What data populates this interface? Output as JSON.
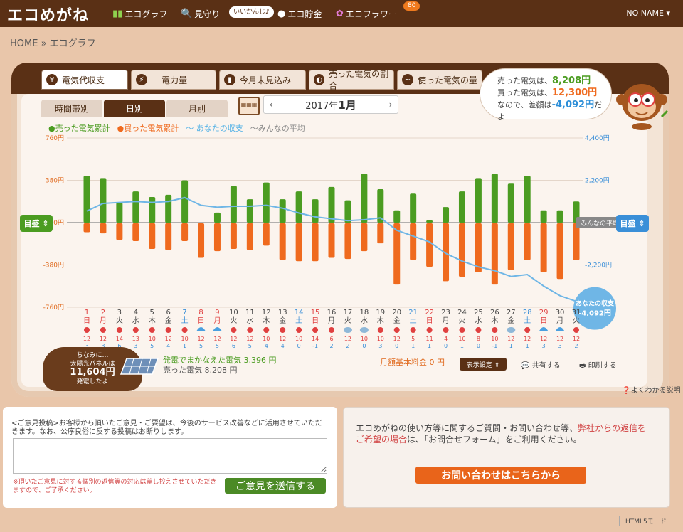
{
  "header": {
    "logo": "エコめがね",
    "nav": [
      {
        "label": "エコグラフ",
        "icon": "bar-chart-icon"
      },
      {
        "label": "見守り",
        "icon": "magnifier-icon"
      },
      {
        "label": "エコ貯金",
        "icon": "coin-icon"
      },
      {
        "label": "エコフラワー",
        "icon": "flower-icon"
      }
    ],
    "tag": "いいかんじ♪",
    "badge": "80",
    "user": "NO NAME ▾"
  },
  "breadcrumb": "HOME » エコグラフ",
  "tabs": [
    {
      "label": "電気代収支",
      "icon": "¥"
    },
    {
      "label": "電力量",
      "icon": "⚡"
    },
    {
      "label": "今月末見込み",
      "icon": "▮"
    },
    {
      "label": "売った電気の割合",
      "icon": "◐"
    },
    {
      "label": "使った電気の量",
      "icon": "~"
    }
  ],
  "subtabs": [
    "時間帯別",
    "日別",
    "月別"
  ],
  "month": {
    "prev": "‹",
    "year": "2017年",
    "mon": "1月",
    "next": "›"
  },
  "summary": {
    "sold_label": "売った電気は、",
    "sold_value": "8,208円",
    "bought_label": "買った電気は、",
    "bought_value": "12,300円",
    "diff_label": "なので、差額は",
    "diff_value": "-4,092円",
    "diff_suffix": "だよ"
  },
  "legend": {
    "sold": "●売った電気累計",
    "bought": "●買った電気累計",
    "balance": "〜 あなたの収支",
    "avg": "〜みんなの平均"
  },
  "meyasu": "目盛",
  "chart_data": {
    "type": "bar",
    "left_axis": {
      "ticks": [
        "760円",
        "380円",
        "0円",
        "-380円",
        "-760円"
      ],
      "range": [
        -760,
        760
      ]
    },
    "right_axis": {
      "ticks": [
        "4,400円",
        "2,200円",
        "",
        "-2,200円"
      ],
      "range": [
        -4400,
        4400
      ]
    },
    "avg_label": "みんなの平均",
    "balance_callout": {
      "title": "あなたの収支",
      "value": "-4,092円"
    },
    "days": [
      "1",
      "2",
      "3",
      "4",
      "5",
      "6",
      "7",
      "8",
      "9",
      "10",
      "11",
      "12",
      "13",
      "14",
      "15",
      "16",
      "17",
      "18",
      "19",
      "20",
      "21",
      "22",
      "23",
      "24",
      "25",
      "26",
      "27",
      "28",
      "29",
      "30",
      "31"
    ],
    "weekdays": [
      "日",
      "月",
      "火",
      "水",
      "木",
      "金",
      "土",
      "日",
      "月",
      "火",
      "水",
      "木",
      "金",
      "土",
      "日",
      "月",
      "火",
      "水",
      "木",
      "金",
      "土",
      "日",
      "月",
      "火",
      "水",
      "木",
      "金",
      "土",
      "日",
      "月",
      "火"
    ],
    "weekday_colors": [
      "#e04040",
      "#e04040",
      "#444",
      "#444",
      "#444",
      "#444",
      "#3a8fd8",
      "#e04040",
      "#e04040",
      "#444",
      "#444",
      "#444",
      "#444",
      "#3a8fd8",
      "#e04040",
      "#444",
      "#444",
      "#444",
      "#444",
      "#444",
      "#3a8fd8",
      "#e04040",
      "#444",
      "#444",
      "#444",
      "#444",
      "#444",
      "#3a8fd8",
      "#e04040",
      "#444",
      "#444"
    ],
    "weather": [
      "sun",
      "sun",
      "sun",
      "sun",
      "sun",
      "sun",
      "sun",
      "rain",
      "rain",
      "sun",
      "sun",
      "sun",
      "sun",
      "sun",
      "sun",
      "sun",
      "cloud",
      "cloud",
      "sun",
      "sun",
      "sun",
      "sun",
      "sun",
      "sun",
      "sun",
      "sun",
      "cloud",
      "sun",
      "rain",
      "rain",
      "sun"
    ],
    "high_temps": [
      "12",
      "12",
      "14",
      "13",
      "10",
      "12",
      "10",
      "12",
      "12",
      "12",
      "12",
      "10",
      "12",
      "10",
      "14",
      "6",
      "12",
      "10",
      "10",
      "12",
      "5",
      "11",
      "4",
      "10",
      "8",
      "10",
      "12",
      "12",
      "12",
      "12",
      "12"
    ],
    "low_temps": [
      "3",
      "3",
      "6",
      "3",
      "5",
      "4",
      "1",
      "5",
      "5",
      "6",
      "5",
      "4",
      "4",
      "0",
      "-1",
      "2",
      "2",
      "0",
      "3",
      "0",
      "1",
      "1",
      "0",
      "1",
      "0",
      "-1",
      "1",
      "1",
      "3",
      "3",
      "2"
    ],
    "series": [
      {
        "name": "売った電気",
        "color": "#4b9c21",
        "values": [
          420,
          400,
          180,
          280,
          230,
          250,
          380,
          0,
          90,
          330,
          210,
          360,
          210,
          280,
          210,
          320,
          200,
          440,
          300,
          110,
          260,
          20,
          140,
          280,
          400,
          440,
          350,
          420,
          110,
          110,
          190
        ]
      },
      {
        "name": "買った電気",
        "color": "#ef6a1e",
        "values": [
          -80,
          -90,
          -150,
          -160,
          -230,
          -240,
          -160,
          -310,
          -250,
          -230,
          -240,
          -200,
          -330,
          -340,
          -340,
          -310,
          -320,
          -250,
          -180,
          -550,
          -330,
          -390,
          -520,
          -480,
          -440,
          -550,
          -420,
          -330,
          -440,
          -500,
          -330
        ]
      },
      {
        "name": "あなたの収支",
        "color": "#6fb6e6",
        "values": [
          600,
          1000,
          1050,
          1100,
          1050,
          1100,
          1300,
          900,
          800,
          850,
          850,
          900,
          750,
          500,
          300,
          200,
          100,
          150,
          250,
          -400,
          -700,
          -1000,
          -1600,
          -2000,
          -2300,
          -2500,
          -2800,
          -2700,
          -3300,
          -3800,
          -4092
        ]
      },
      {
        "name": "みんなの平均",
        "color": "#999999",
        "values": [
          0,
          0,
          0,
          0,
          0,
          0,
          0,
          0,
          0,
          0,
          0,
          0,
          0,
          0,
          0,
          0,
          0,
          0,
          0,
          0,
          0,
          0,
          0,
          0,
          0,
          0,
          0,
          0,
          0,
          0,
          0
        ]
      }
    ]
  },
  "bottom": {
    "info_line1": "ちなみに…",
    "info_line2": "太陽光パネルは",
    "info_value": "11,604円",
    "info_line3": "発電したよ",
    "gen_label": "発電でまかなえた電気 3,396 円",
    "sold_label": "売った電気 8,208 円",
    "kihon": "月額基本料金 0 円",
    "display_btn": "表示設定 ⇕",
    "share": "共有する",
    "print": "印刷する",
    "help": "よくわかる説明"
  },
  "feedback": {
    "text": "<ご意見投稿>お客様から頂いたご意見・ご要望は、今後のサービス改善などに活用させていただきます。なお、公序良俗に反する投稿はお断りします。",
    "note": "※頂いたご意見に対する個別の返信等の対応は差し控えさせていただきますので、ご了承ください。",
    "send": "ご意見を送信する"
  },
  "contact": {
    "text1": "エコめがねの使い方等に関するご質問・お問い合わせ等、",
    "text_red": "弊社からの返信をご希望の場合",
    "text2": "は、「お問合せフォーム」をご利用ください。",
    "button": "お問い合わせはこちらから"
  },
  "footer": "HTML5モード"
}
